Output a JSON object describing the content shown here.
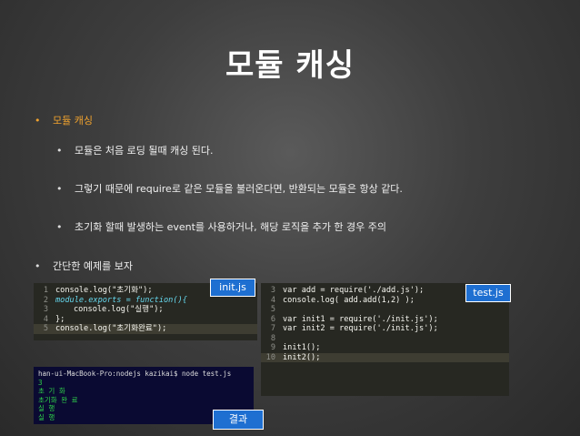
{
  "title": "모듈 캐싱",
  "bullets": {
    "b1": "모듈 캐싱",
    "b2": "모듈은 처음 로딩 될때 캐싱 된다.",
    "b3": "그렇기 때문에 require로 같은 모듈을 불러온다면, 반환되는 모듈은 항상 같다.",
    "b4": "초기화 할때 발생하는 event를 사용하거나, 해당 로직을 추가 한 경우 주의",
    "b5": "간단한 예제를 보자",
    "dot": "•"
  },
  "init_code": {
    "l1": [
      "1",
      "console.log(\"초기화\");"
    ],
    "l2": [
      "2",
      "module.exports = function(){"
    ],
    "l3": [
      "3",
      "console.log(\"실행\");"
    ],
    "l4": [
      "4",
      "};"
    ],
    "l5": [
      "5",
      "console.log(\"초기화완료\");"
    ]
  },
  "test_code": {
    "l3": [
      "3",
      "var add = require('./add.js');"
    ],
    "l4": [
      "4",
      "console.log( add.add(1,2) );"
    ],
    "l5": [
      "5",
      ""
    ],
    "l6": [
      "6",
      "var init1 = require('./init.js');"
    ],
    "l7": [
      "7",
      "var init2 = require('./init.js');"
    ],
    "l8": [
      "8",
      ""
    ],
    "l9": [
      "9",
      "init1();"
    ],
    "l10": [
      "10",
      "init2();"
    ]
  },
  "terminal": {
    "prompt": "han-ui-MacBook-Pro:nodejs kazikai$ node test.js",
    "out1": "3",
    "out2": "초 기 화",
    "out3": "초기화 완 료",
    "out4": "실 행",
    "out5": "실 행"
  },
  "labels": {
    "init": "init.js",
    "test": "test.js",
    "result": "결과"
  }
}
